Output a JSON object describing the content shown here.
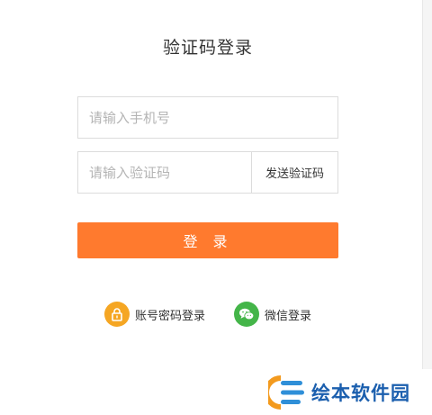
{
  "page": {
    "title": "验证码登录"
  },
  "form": {
    "phone_placeholder": "请输入手机号",
    "code_placeholder": "请输入验证码",
    "send_code_label": "发送验证码",
    "login_label": "登 录"
  },
  "alt_logins": {
    "password_label": "账号密码登录",
    "password_icon": "lock-icon",
    "wechat_label": "微信登录",
    "wechat_icon": "wechat-icon"
  },
  "watermark": {
    "text": "绘本软件园"
  },
  "colors": {
    "accent": "#ff7a2e",
    "lock_icon_bg": "#f5a623",
    "wechat_icon_bg": "#44b549",
    "watermark_text": "#1b5fae"
  }
}
